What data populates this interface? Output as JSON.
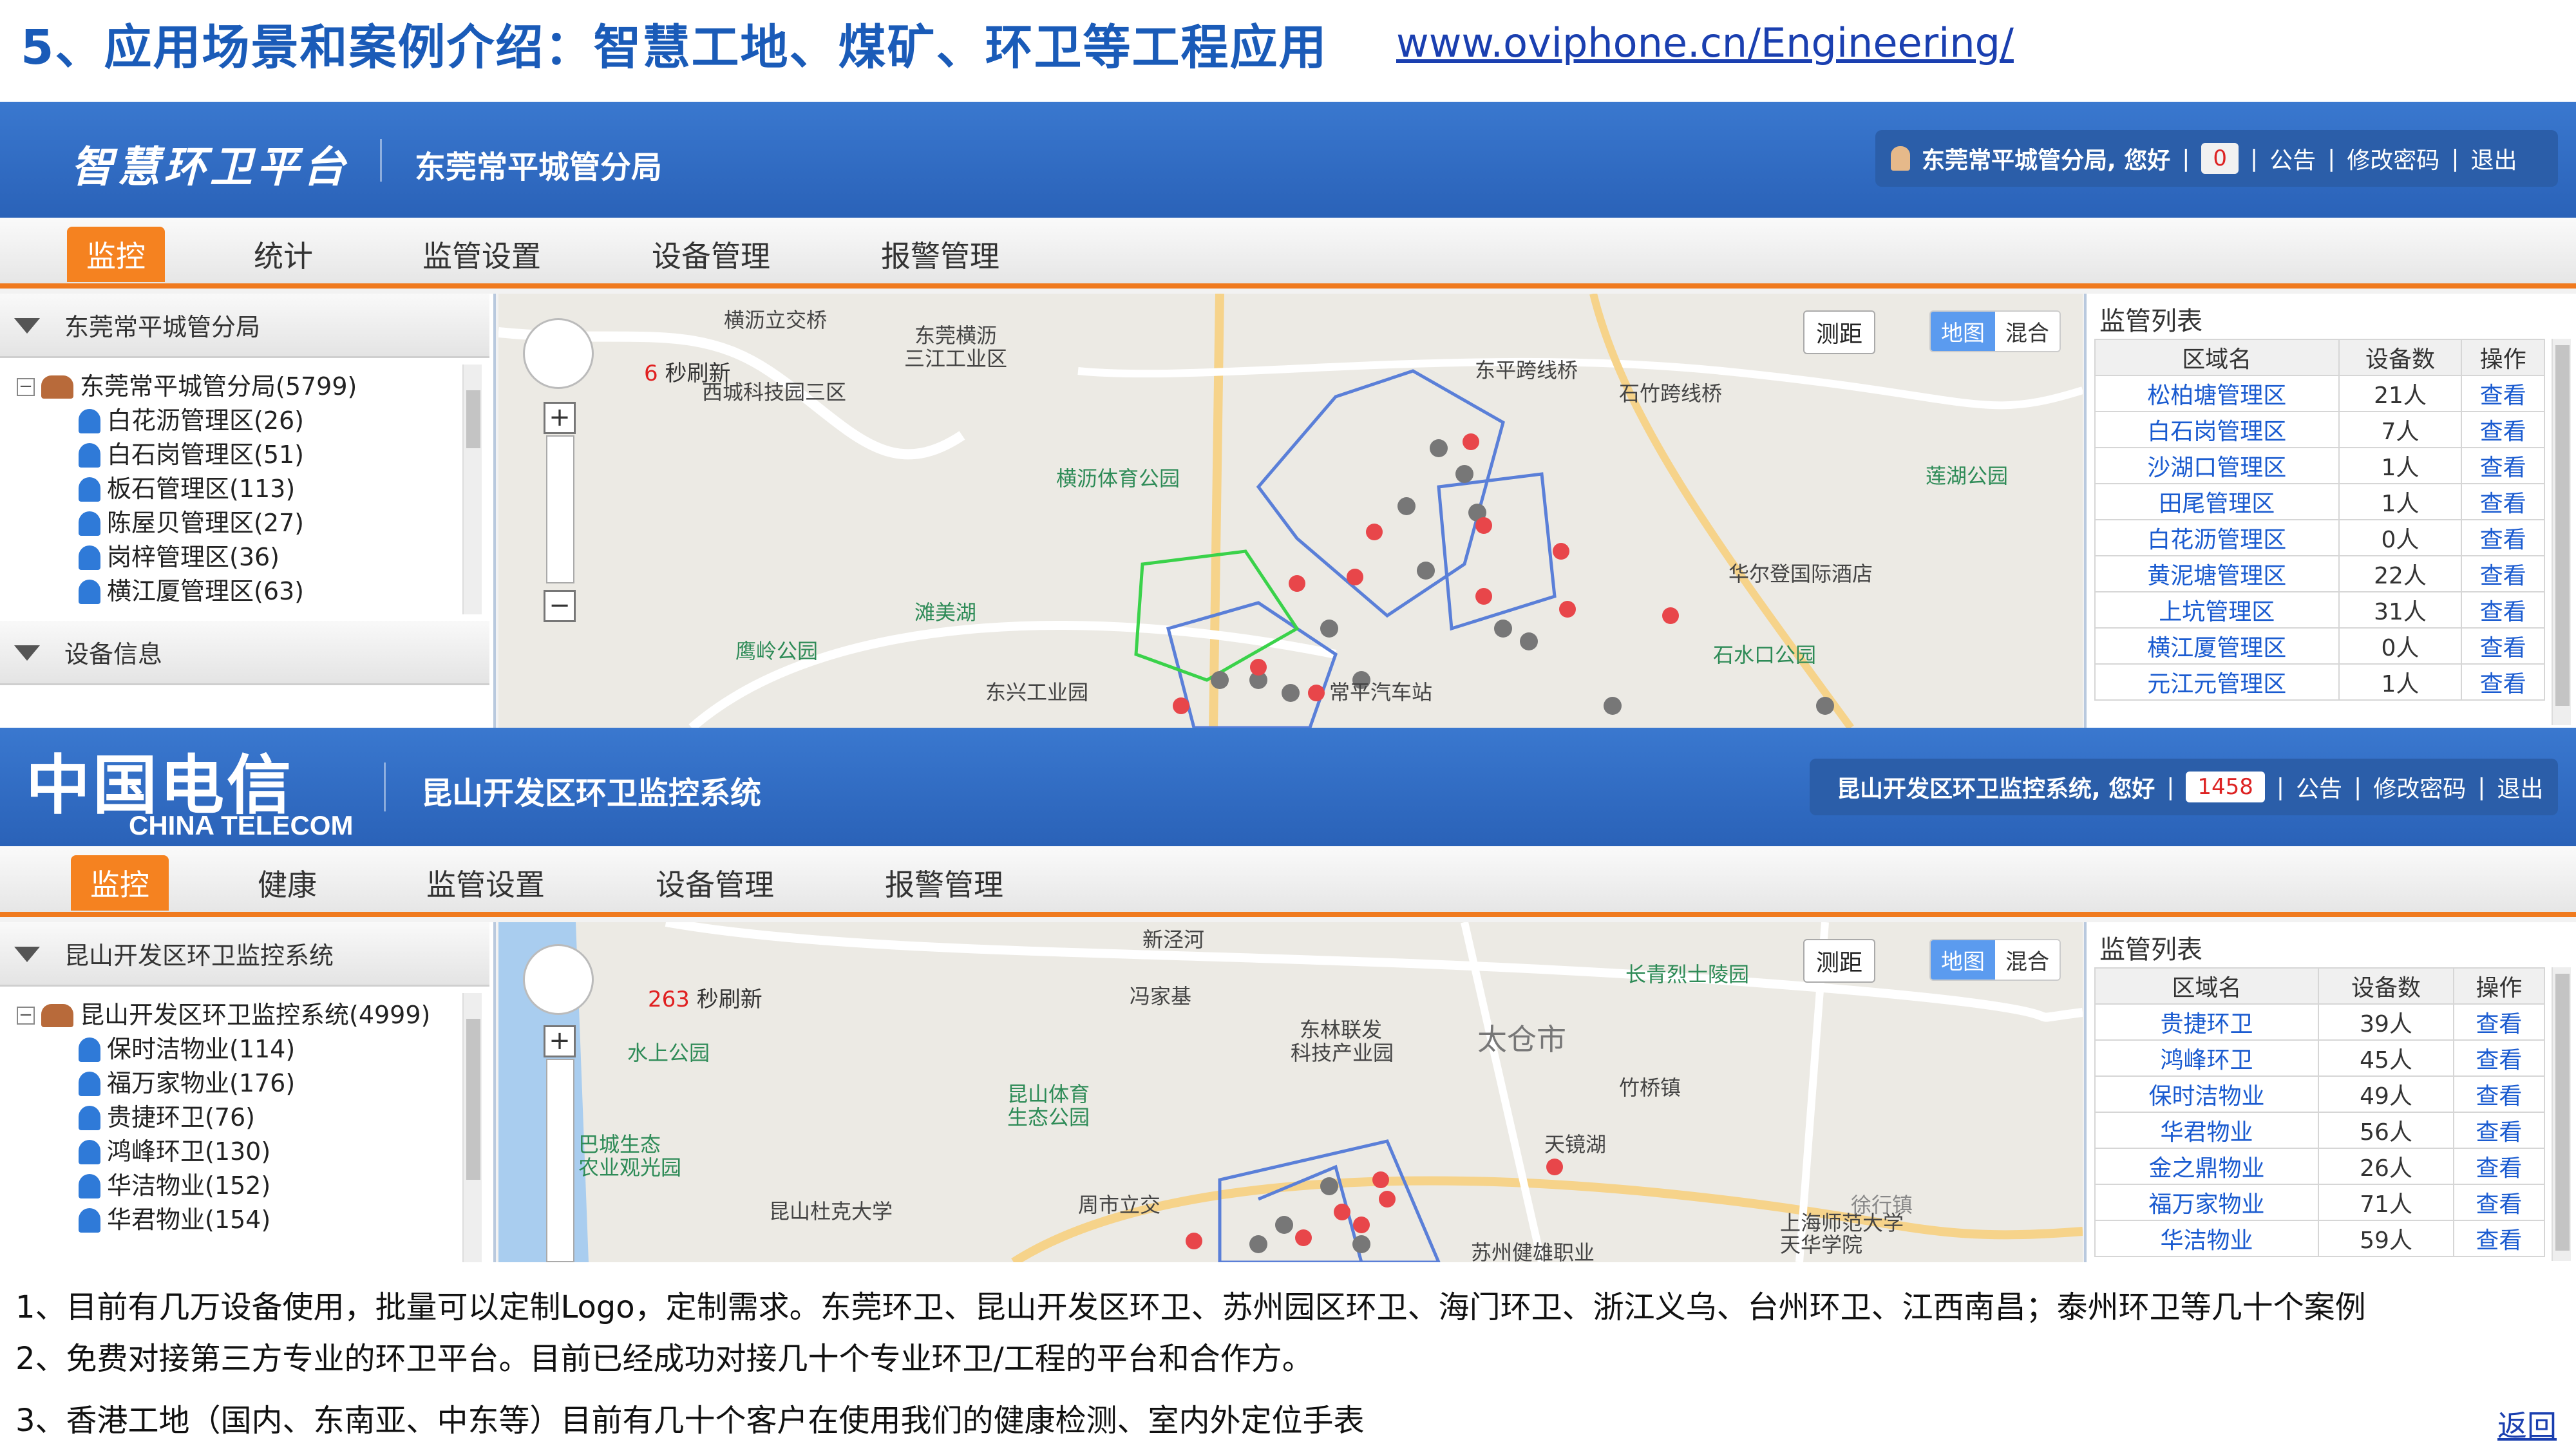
{
  "slide": {
    "title": "5、应用场景和案例介绍：智慧工地、煤矿、环卫等工程应用",
    "link": "www.oviphone.cn/Engineering/",
    "notes": [
      "1、目前有几万设备使用，批量可以定制Logo，定制需求。东莞环卫、昆山开发区环卫、苏州园区环卫、海门环卫、浙江义乌、台州环卫、江西南昌；泰州环卫等几十个案例",
      "2、免费对接第三方专业的环卫平台。目前已经成功对接几十个专业环卫/工程的平台和合作方。",
      "3、香港工地（国内、东南亚、中东等）目前有几十个客户在使用我们的健康检测、室内外定位手表"
    ],
    "back_link": "返回"
  },
  "colors": {
    "accent": "#f58220",
    "header_blue": "#2a62b8",
    "title_blue": "#1a5bb8",
    "link_blue": "#1a5bd0"
  },
  "top_panel": {
    "logo": "智慧环卫平台",
    "system_name": "东莞常平城管分局",
    "user_greeting": "东莞常平城管分局, 您好",
    "alert_count": "0",
    "links": [
      "公告",
      "修改密码",
      "退出"
    ],
    "nav": [
      "监控",
      "统计",
      "监管设置",
      "设备管理",
      "报警管理"
    ],
    "tree_header": "东莞常平城管分局",
    "tree_root": "东莞常平城管分局(5799)",
    "tree_items": [
      "白花沥管理区(26)",
      "白石岗管理区(51)",
      "板石管理区(113)",
      "陈屋贝管理区(27)",
      "岗梓管理区(36)",
      "横江厦管理区(63)"
    ],
    "device_section": "设备信息",
    "refresh_seconds": "6",
    "refresh_label": "秒刷新",
    "measure_btn": "测距",
    "map_toggle": [
      "地图",
      "混合"
    ],
    "map_labels": [
      "横沥立交桥",
      "东莞横沥",
      "三江工业区",
      "西城科技园三区",
      "东平跨线桥",
      "石竹跨线桥",
      "横沥体育公园",
      "莲湖公园",
      "滩美湖",
      "华尔登国际酒店",
      "鹰岭公园",
      "石水口公园",
      "东兴工业园",
      "常平汽车站"
    ],
    "list_title": "监管列表",
    "list_headers": [
      "区域名",
      "设备数",
      "操作"
    ],
    "list_rows": [
      [
        "松柏塘管理区",
        "21人",
        "查看"
      ],
      [
        "白石岗管理区",
        "7人",
        "查看"
      ],
      [
        "沙湖口管理区",
        "1人",
        "查看"
      ],
      [
        "田尾管理区",
        "1人",
        "查看"
      ],
      [
        "白花沥管理区",
        "0人",
        "查看"
      ],
      [
        "黄泥塘管理区",
        "22人",
        "查看"
      ],
      [
        "上坑管理区",
        "31人",
        "查看"
      ],
      [
        "横江厦管理区",
        "0人",
        "查看"
      ],
      [
        "元江元管理区",
        "1人",
        "查看"
      ]
    ]
  },
  "bottom_panel": {
    "logo": "中国电信",
    "logo_en": "CHINA TELECOM",
    "system_name": "昆山开发区环卫监控系统",
    "user_greeting": "昆山开发区环卫监控系统, 您好",
    "alert_count": "1458",
    "links": [
      "公告",
      "修改密码",
      "退出"
    ],
    "nav": [
      "监控",
      "健康",
      "监管设置",
      "设备管理",
      "报警管理"
    ],
    "tree_header": "昆山开发区环卫监控系统",
    "tree_root": "昆山开发区环卫监控系统(4999)",
    "tree_items": [
      "保时洁物业(114)",
      "福万家物业(176)",
      "贵捷环卫(76)",
      "鸿峰环卫(130)",
      "华洁物业(152)",
      "华君物业(154)"
    ],
    "refresh_seconds": "263",
    "refresh_label": "秒刷新",
    "measure_btn": "测距",
    "map_toggle": [
      "地图",
      "混合"
    ],
    "map_labels": [
      "新泾河",
      "长青烈士陵园",
      "冯家基",
      "东林联发",
      "科技产业园",
      "太仓市",
      "水上公园",
      "昆山体育",
      "生态公园",
      "竹桥镇",
      "巴城生态",
      "农业观光园",
      "天镜湖",
      "昆山杜克大学",
      "周市立交",
      "上海师范大学",
      "天华学院",
      "苏州健雄职业",
      "徐行镇"
    ],
    "list_title": "监管列表",
    "list_headers": [
      "区域名",
      "设备数",
      "操作"
    ],
    "list_rows": [
      [
        "贵捷环卫",
        "39人",
        "查看"
      ],
      [
        "鸿峰环卫",
        "45人",
        "查看"
      ],
      [
        "保时洁物业",
        "49人",
        "查看"
      ],
      [
        "华君物业",
        "56人",
        "查看"
      ],
      [
        "金之鼎物业",
        "26人",
        "查看"
      ],
      [
        "福万家物业",
        "71人",
        "查看"
      ],
      [
        "华洁物业",
        "59人",
        "查看"
      ]
    ]
  }
}
